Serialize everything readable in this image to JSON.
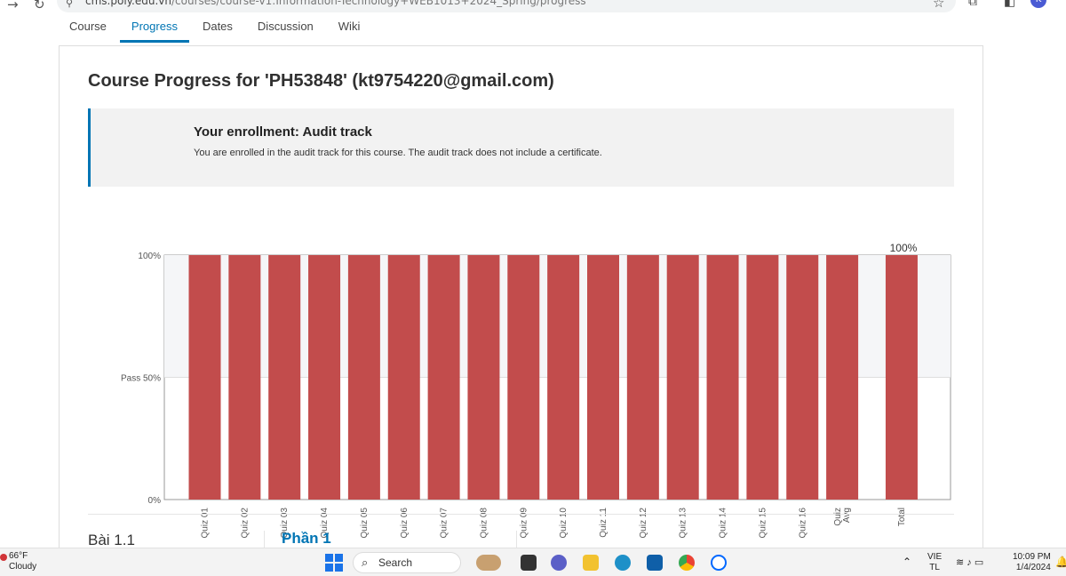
{
  "browser": {
    "url_main": "cms.poly.edu.vn",
    "url_path": "/courses/course-v1:Information-Technology+WEB1013+2024_Spring/progress"
  },
  "tabs": [
    {
      "label": "Course"
    },
    {
      "label": "Progress",
      "active": true
    },
    {
      "label": "Dates"
    },
    {
      "label": "Discussion"
    },
    {
      "label": "Wiki"
    }
  ],
  "page": {
    "title": "Course Progress for 'PH53848' (kt9754220@gmail.com)"
  },
  "enrollment": {
    "title": "Your enrollment: Audit track",
    "text": "You are enrolled in the audit track for this course. The audit track does not include a certificate."
  },
  "colors": {
    "accent": "#0075b4",
    "bar": "#c24c4c",
    "pass_band": "#f5f6f8"
  },
  "chart_data": {
    "type": "bar",
    "categories": [
      "Quiz 01",
      "Quiz 02",
      "Quiz 03",
      "Quiz 04",
      "Quiz 05",
      "Quiz 06",
      "Quiz 07",
      "Quiz 08",
      "Quiz 09",
      "Quiz 10",
      "Quiz 11",
      "Quiz 12",
      "Quiz 13",
      "Quiz 14",
      "Quiz 15",
      "Quiz 16",
      "Quiz Avg",
      "Total"
    ],
    "values": [
      100,
      100,
      100,
      100,
      100,
      100,
      100,
      100,
      100,
      100,
      100,
      100,
      100,
      100,
      100,
      100,
      100,
      100
    ],
    "ylim": [
      0,
      100
    ],
    "yticks": [
      {
        "value": 100,
        "label": "100%"
      },
      {
        "value": 50,
        "label": "Pass 50%"
      },
      {
        "value": 0,
        "label": "0%"
      }
    ],
    "total_label": "100%"
  },
  "sections": {
    "left": "Bài 1.1",
    "right": "Phần 1"
  },
  "taskbar": {
    "temp": "66°F",
    "condition": "Cloudy",
    "search_placeholder": "Search",
    "lang_1": "VIE",
    "lang_2": "TL",
    "time": "10:09 PM",
    "date": "1/4/2024"
  }
}
